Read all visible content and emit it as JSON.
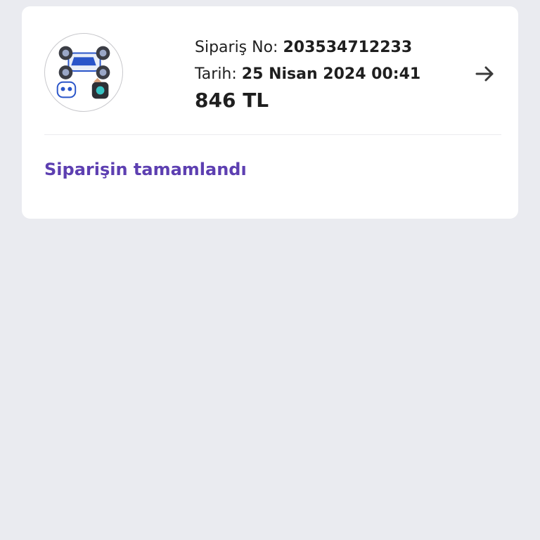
{
  "order": {
    "order_no_label": "Sipariş No:",
    "order_no_value": "203534712233",
    "date_label": "Tarih:",
    "date_value": "25 Nisan 2024 00:41",
    "price": "846 TL",
    "status": "Siparişin tamamlandı",
    "product_image_icon": "rc-stunt-car-with-controllers",
    "arrow_icon": "arrow-right-icon"
  },
  "colors": {
    "background": "#eaebf0",
    "card": "#ffffff",
    "status_text": "#5d3fb1",
    "primary_text": "#1f1f1f"
  }
}
